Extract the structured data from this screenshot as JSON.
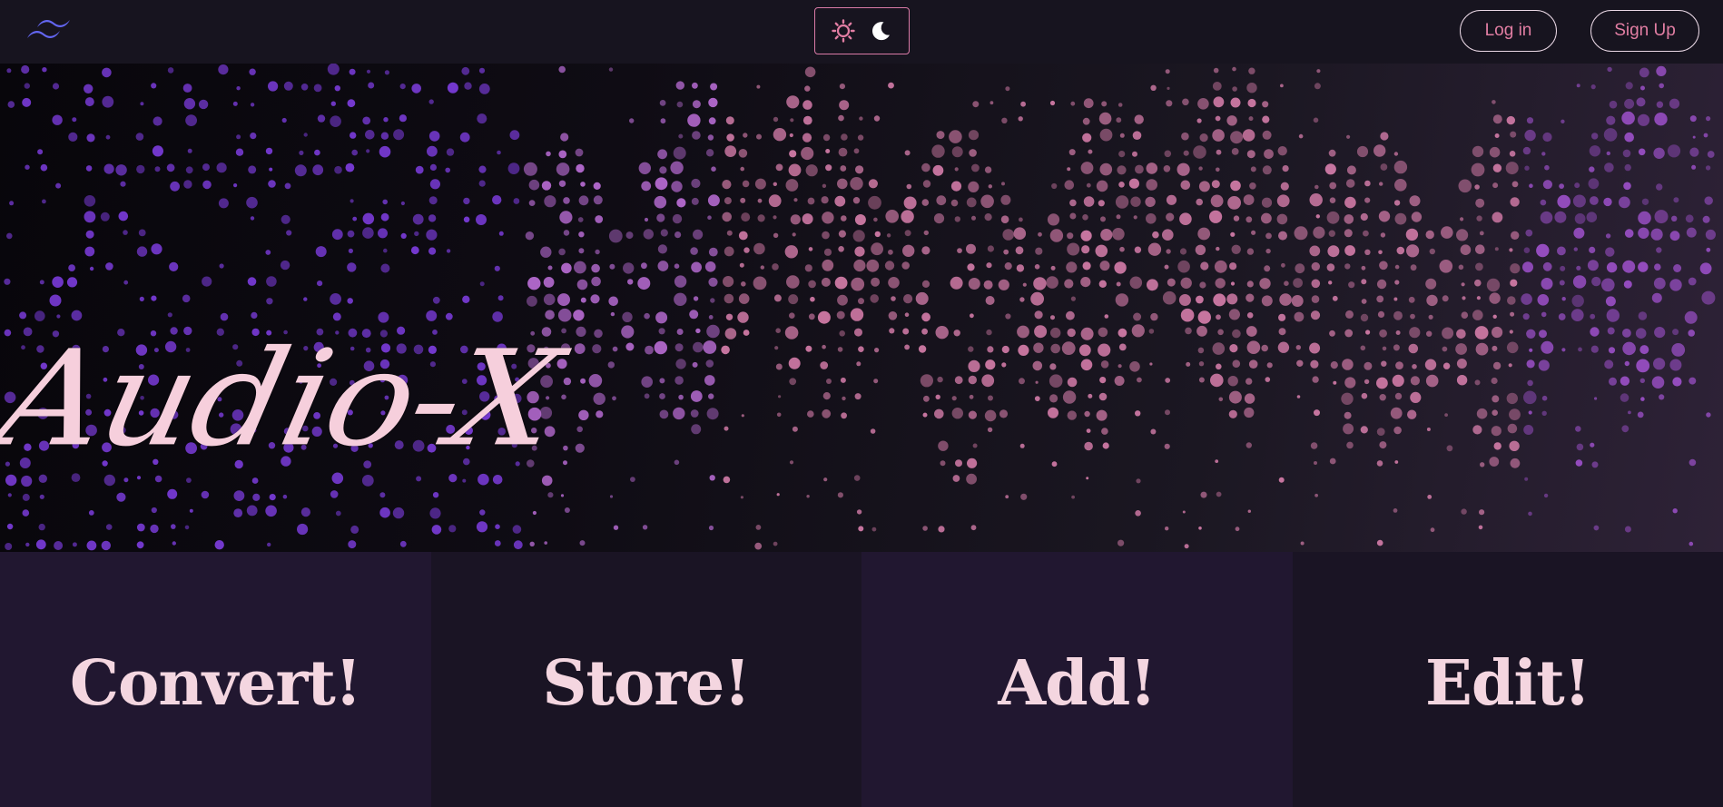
{
  "navbar": {
    "logo_icon": "tailwind-logo-icon",
    "theme_toggle": {
      "light_icon": "sun-icon",
      "dark_icon": "moon-icon"
    },
    "login_label": "Log in",
    "signup_label": "Sign Up"
  },
  "hero": {
    "title": "Audio-X",
    "background": "audio-equalizer-dots"
  },
  "features": [
    {
      "label": "Convert!"
    },
    {
      "label": "Store!"
    },
    {
      "label": "Add!"
    },
    {
      "label": "Edit!"
    }
  ],
  "colors": {
    "accent": "#e27ea3",
    "title": "#f6cfdc",
    "logo": "#6366f1",
    "background": "#17141f"
  }
}
